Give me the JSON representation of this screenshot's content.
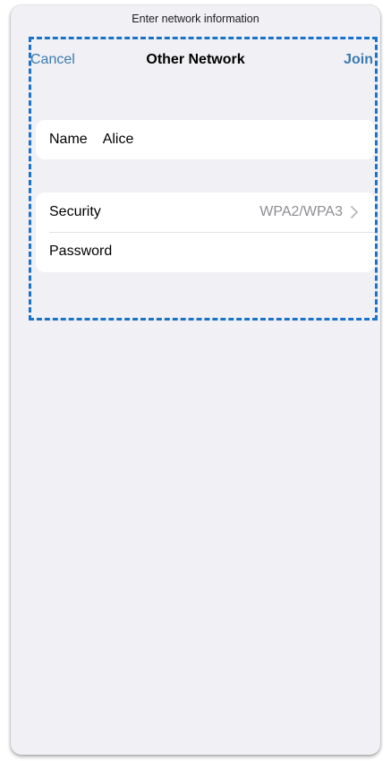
{
  "sheet": {
    "prompt": "Enter network information"
  },
  "nav": {
    "cancel_label": "Cancel",
    "title": "Other Network",
    "join_label": "Join"
  },
  "name_row": {
    "label": "Name",
    "value": "Alice"
  },
  "security_row": {
    "label": "Security",
    "value": "WPA2/WPA3",
    "icon": "chevron-right-icon"
  },
  "password_row": {
    "label": "Password",
    "value": ""
  },
  "colors": {
    "accent": "#3a7ab0",
    "background": "#f1f0f5",
    "highlight": "#1a73c9",
    "secondary_text": "#8e8e93"
  }
}
